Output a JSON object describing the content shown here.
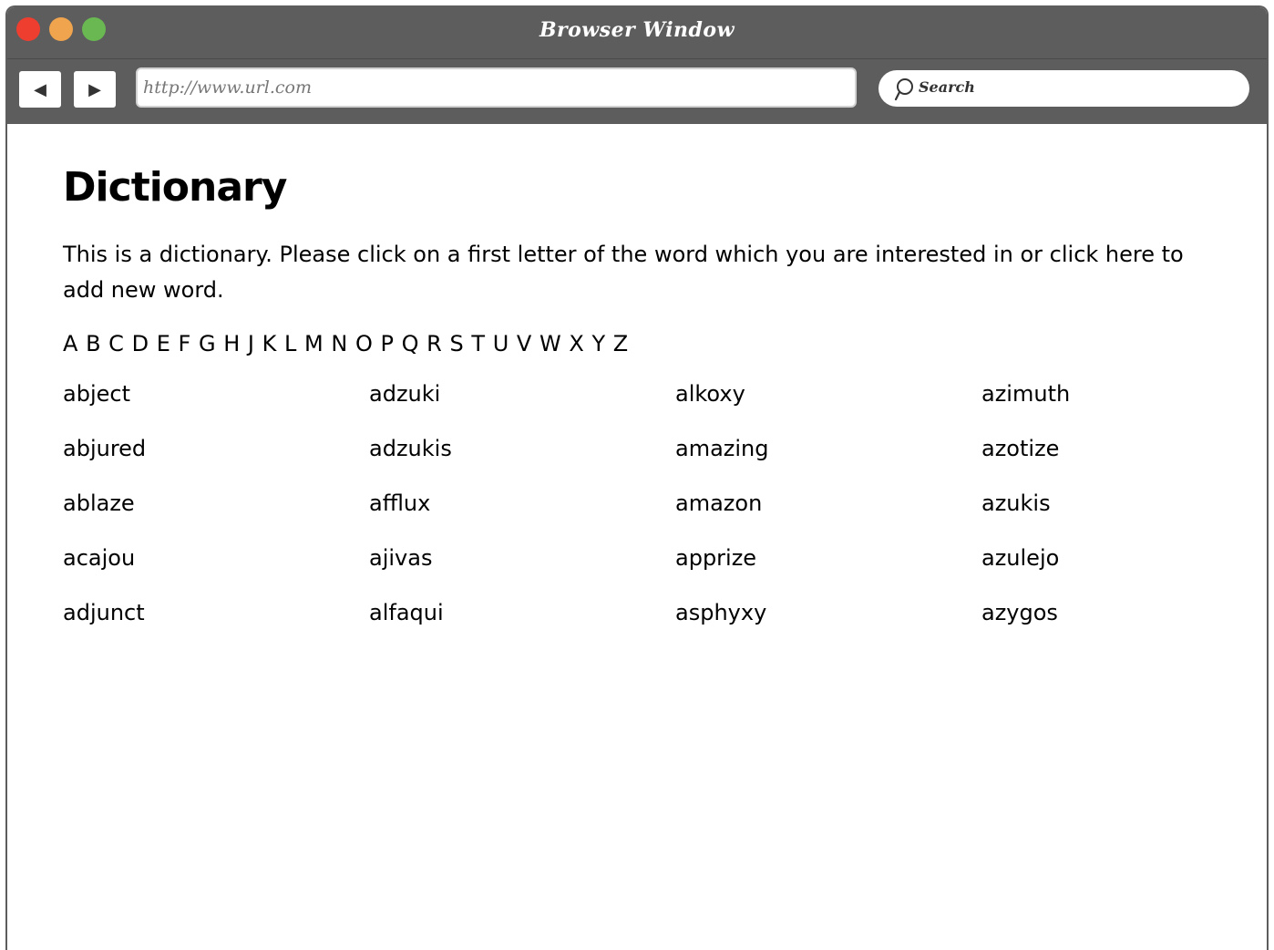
{
  "window": {
    "title": "Browser Window"
  },
  "toolbar": {
    "back_icon": "◀",
    "forward_icon": "▶",
    "url": "http://www.url.com",
    "search_placeholder": "Search"
  },
  "page": {
    "heading": "Dictionary",
    "intro": "This is a dictionary. Please click on a first letter of the word which you are interested in or click here to add new word.",
    "letters": [
      "A",
      "B",
      "C",
      "D",
      "E",
      "F",
      "G",
      "H",
      "J",
      "K",
      "L",
      "M",
      "N",
      "O",
      "P",
      "Q",
      "R",
      "S",
      "T",
      "U",
      "V",
      "W",
      "X",
      "Y",
      "Z"
    ],
    "words": [
      "abject",
      "adzuki",
      "alkoxy",
      "azimuth",
      "abjured",
      "adzukis",
      "amazing",
      "azotize",
      "ablaze",
      "afflux",
      "amazon",
      "azukis",
      "acajou",
      "ajivas",
      "apprize",
      "azulejo",
      "adjunct",
      "alfaqui",
      "asphyxy",
      "azygos"
    ]
  },
  "colors": {
    "chrome": "#5d5d5d",
    "traffic_red": "#ee3e2f",
    "traffic_yellow": "#f0a44e",
    "traffic_green": "#6ab852"
  }
}
